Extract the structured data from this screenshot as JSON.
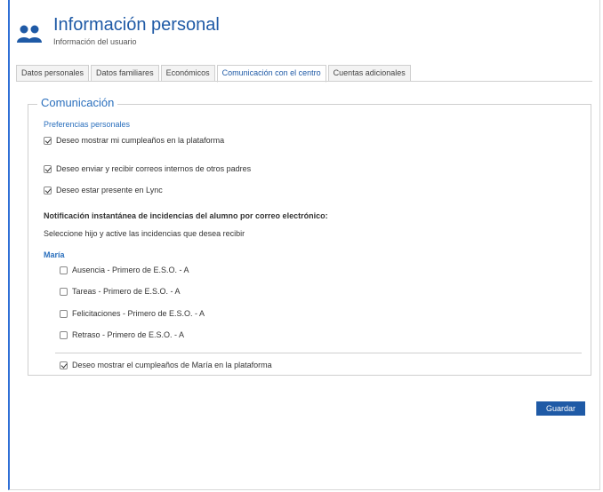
{
  "header": {
    "title": "Información personal",
    "subtitle": "Información del usuario",
    "icon": "users-icon",
    "accent_color": "#1f5aa6"
  },
  "tabs": [
    {
      "label": "Datos personales",
      "active": false
    },
    {
      "label": "Datos familiares",
      "active": false
    },
    {
      "label": "Económicos",
      "active": false
    },
    {
      "label": "Comunicación con el centro",
      "active": true
    },
    {
      "label": "Cuentas adicionales",
      "active": false
    }
  ],
  "section": {
    "legend": "Comunicación",
    "preferences_label": "Preferencias personales",
    "options": [
      {
        "label": "Deseo mostrar mi cumpleaños en la plataforma",
        "checked": true
      },
      {
        "label": "Deseo enviar y recibir correos internos de otros padres",
        "checked": true
      },
      {
        "label": "Deseo estar presente en Lync",
        "checked": true
      }
    ],
    "notification_title": "Notificación instantánea de incidencias del alumno por correo electrónico:",
    "notification_help": "Seleccione hijo y active las incidencias que desea recibir",
    "child_name": "María",
    "incidents": [
      {
        "label": "Ausencia - Primero de E.S.O. - A",
        "checked": false
      },
      {
        "label": "Tareas - Primero de E.S.O. - A",
        "checked": false
      },
      {
        "label": "Felicitaciones - Primero de E.S.O. - A",
        "checked": false
      },
      {
        "label": "Retraso - Primero de E.S.O. - A",
        "checked": false
      }
    ],
    "child_birthday": {
      "label": "Deseo mostrar el cumpleaños de María en la plataforma",
      "checked": true
    }
  },
  "actions": {
    "save_label": "Guardar"
  }
}
